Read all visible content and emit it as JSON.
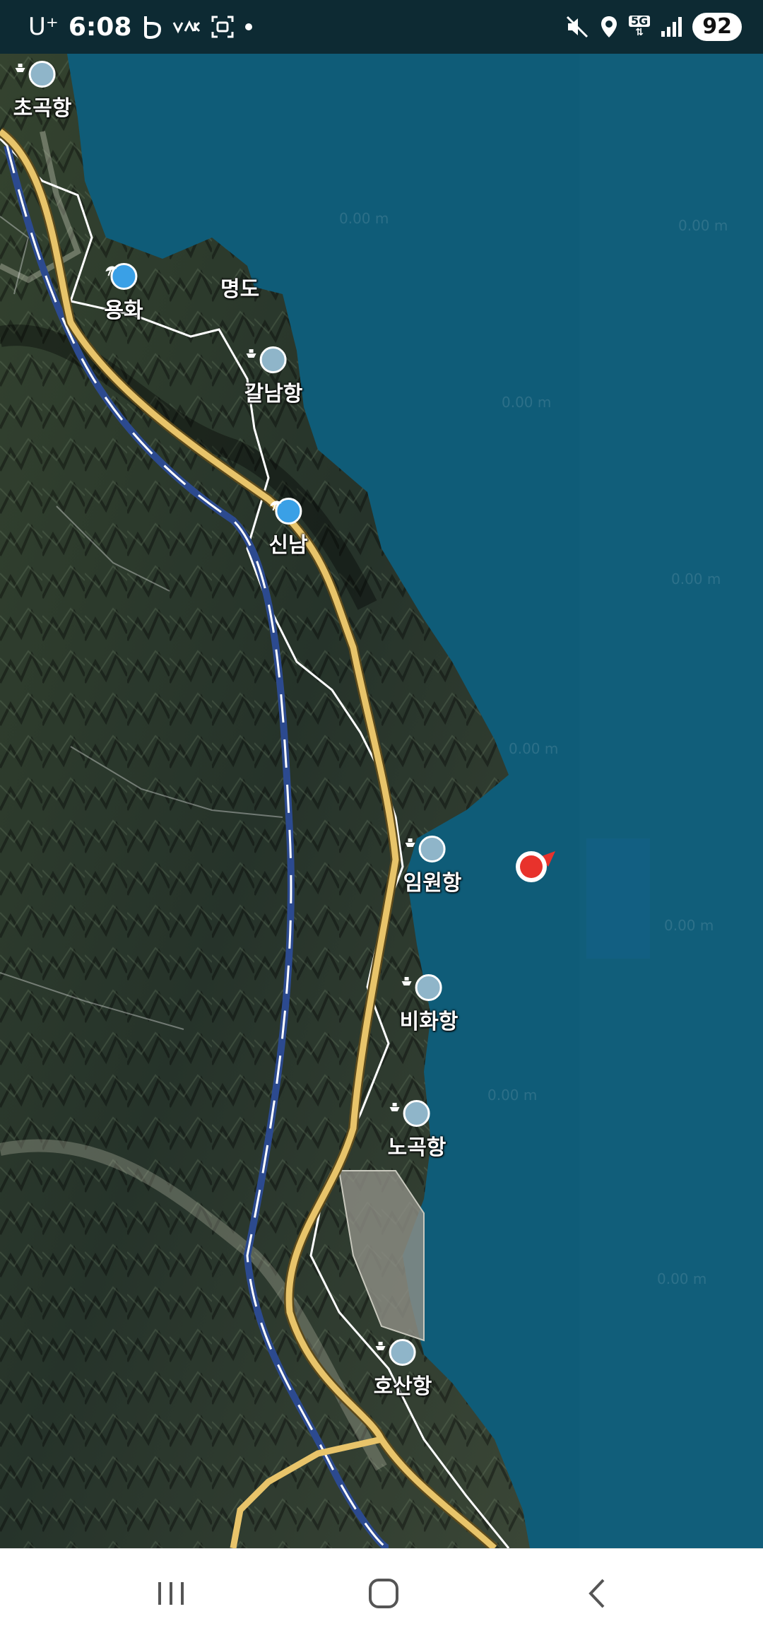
{
  "status_bar": {
    "carrier": "U⁺",
    "time": "6:08",
    "left_icons": [
      "b-app-icon",
      "kakao-icon",
      "screenshot-icon",
      "dot-icon"
    ],
    "right_icons": [
      "mute-vibrate-icon",
      "location-icon",
      "5g-icon",
      "signal-icon"
    ],
    "network": "5G",
    "battery": "92"
  },
  "map": {
    "type": "satellite",
    "colors": {
      "sea": "#0f5c78",
      "land": "#2c3a2e",
      "highway": "#e8c46a",
      "railway": "#2c4a8f",
      "road": "#ffffff",
      "location_dot": "#e8322c"
    },
    "labels": [
      {
        "name": "초곡항",
        "kind": "port"
      },
      {
        "name": "용화",
        "kind": "beach"
      },
      {
        "name": "명도",
        "kind": "place"
      },
      {
        "name": "갈남항",
        "kind": "port"
      },
      {
        "name": "신남",
        "kind": "beach"
      },
      {
        "name": "임원항",
        "kind": "port"
      },
      {
        "name": "비화항",
        "kind": "port"
      },
      {
        "name": "노곡항",
        "kind": "port"
      },
      {
        "name": "호산항",
        "kind": "port"
      }
    ],
    "current_location_icon": "location-dot-icon"
  },
  "nav_bar": {
    "buttons": [
      "recent-apps-icon",
      "home-icon",
      "back-icon"
    ]
  }
}
